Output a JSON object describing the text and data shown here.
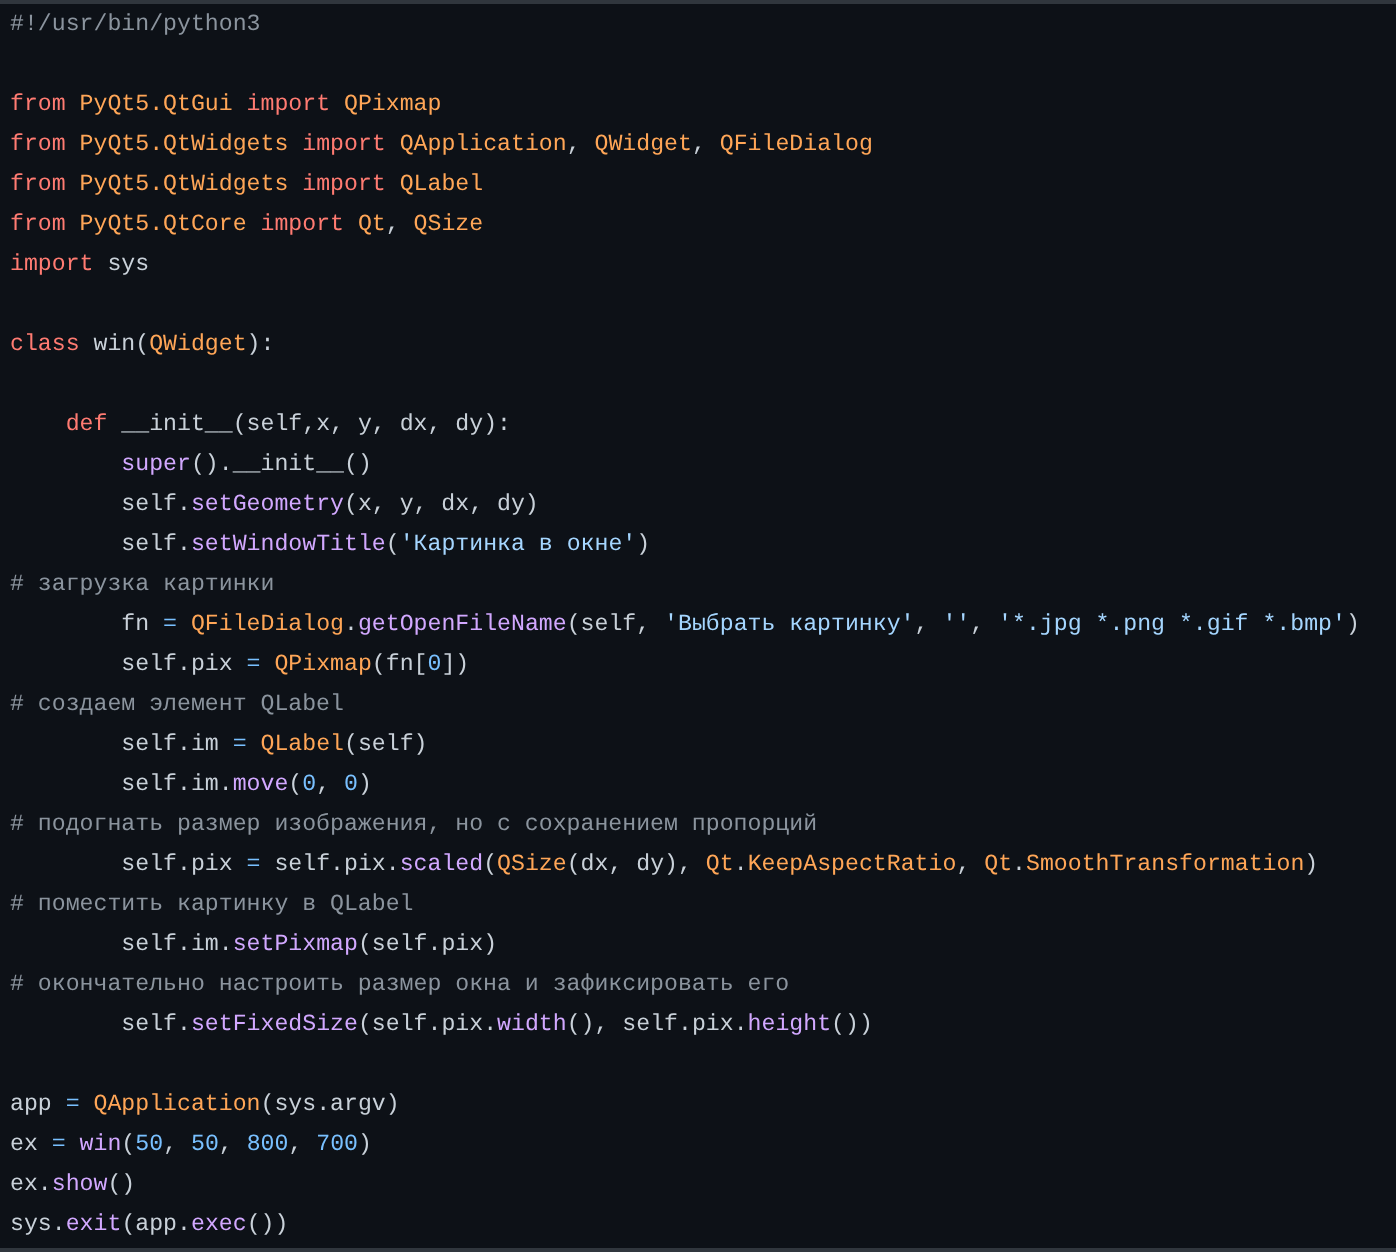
{
  "code_lines": [
    {
      "kind": "code",
      "tokens": [
        {
          "text": "#!/usr/bin/python3",
          "kind": "comment"
        }
      ]
    },
    {
      "kind": "blank"
    },
    {
      "kind": "code",
      "tokens": [
        {
          "text": "from ",
          "kind": "keyword"
        },
        {
          "text": "PyQt5.QtGui ",
          "kind": "class"
        },
        {
          "text": "import ",
          "kind": "keyword"
        },
        {
          "text": "QPixmap",
          "kind": "class"
        }
      ]
    },
    {
      "kind": "code",
      "tokens": [
        {
          "text": "from ",
          "kind": "keyword"
        },
        {
          "text": "PyQt5.QtWidgets ",
          "kind": "class"
        },
        {
          "text": "import ",
          "kind": "keyword"
        },
        {
          "text": "QApplication",
          "kind": "class"
        },
        {
          "text": ", ",
          "kind": "plain"
        },
        {
          "text": "QWidget",
          "kind": "class"
        },
        {
          "text": ", ",
          "kind": "plain"
        },
        {
          "text": "QFileDialog",
          "kind": "class"
        }
      ]
    },
    {
      "kind": "code",
      "tokens": [
        {
          "text": "from ",
          "kind": "keyword"
        },
        {
          "text": "PyQt5.QtWidgets ",
          "kind": "class"
        },
        {
          "text": "import ",
          "kind": "keyword"
        },
        {
          "text": "QLabel",
          "kind": "class"
        }
      ]
    },
    {
      "kind": "code",
      "tokens": [
        {
          "text": "from ",
          "kind": "keyword"
        },
        {
          "text": "PyQt5.QtCore ",
          "kind": "class"
        },
        {
          "text": "import ",
          "kind": "keyword"
        },
        {
          "text": "Qt",
          "kind": "class"
        },
        {
          "text": ", ",
          "kind": "plain"
        },
        {
          "text": "QSize",
          "kind": "class"
        }
      ]
    },
    {
      "kind": "code",
      "tokens": [
        {
          "text": "import ",
          "kind": "keyword"
        },
        {
          "text": "sys",
          "kind": "plain"
        }
      ]
    },
    {
      "kind": "blank"
    },
    {
      "kind": "code",
      "tokens": [
        {
          "text": "class ",
          "kind": "keyword"
        },
        {
          "text": "win(",
          "kind": "plain"
        },
        {
          "text": "QWidget",
          "kind": "class"
        },
        {
          "text": "):",
          "kind": "plain"
        }
      ]
    },
    {
      "kind": "blank"
    },
    {
      "kind": "code",
      "tokens": [
        {
          "text": "    def ",
          "kind": "keyword"
        },
        {
          "text": "__init__(self,x, y, dx, dy):",
          "kind": "plain"
        }
      ]
    },
    {
      "kind": "code",
      "tokens": [
        {
          "text": "        super",
          "kind": "function"
        },
        {
          "text": "().__init__()",
          "kind": "plain"
        }
      ]
    },
    {
      "kind": "code",
      "tokens": [
        {
          "text": "        self.",
          "kind": "plain"
        },
        {
          "text": "setGeometry",
          "kind": "function"
        },
        {
          "text": "(x, y, dx, dy)",
          "kind": "plain"
        }
      ]
    },
    {
      "kind": "code",
      "tokens": [
        {
          "text": "        self.",
          "kind": "plain"
        },
        {
          "text": "setWindowTitle",
          "kind": "function"
        },
        {
          "text": "(",
          "kind": "plain"
        },
        {
          "text": "'Картинка в окне'",
          "kind": "string"
        },
        {
          "text": ")",
          "kind": "plain"
        }
      ]
    },
    {
      "kind": "code",
      "tokens": [
        {
          "text": "# загрузка картинки",
          "kind": "comment"
        }
      ]
    },
    {
      "kind": "code",
      "tokens": [
        {
          "text": "        fn ",
          "kind": "plain"
        },
        {
          "text": "= ",
          "kind": "operator"
        },
        {
          "text": "QFileDialog",
          "kind": "class"
        },
        {
          "text": ".",
          "kind": "plain"
        },
        {
          "text": "getOpenFileName",
          "kind": "function"
        },
        {
          "text": "(self, ",
          "kind": "plain"
        },
        {
          "text": "'Выбрать картинку'",
          "kind": "string"
        },
        {
          "text": ", ",
          "kind": "plain"
        },
        {
          "text": "''",
          "kind": "string"
        },
        {
          "text": ", ",
          "kind": "plain"
        },
        {
          "text": "'*.jpg *.png *.gif *.bmp'",
          "kind": "string"
        },
        {
          "text": ")",
          "kind": "plain"
        }
      ]
    },
    {
      "kind": "code",
      "tokens": [
        {
          "text": "        self.pix ",
          "kind": "plain"
        },
        {
          "text": "= ",
          "kind": "operator"
        },
        {
          "text": "QPixmap",
          "kind": "class"
        },
        {
          "text": "(fn[",
          "kind": "plain"
        },
        {
          "text": "0",
          "kind": "number"
        },
        {
          "text": "])",
          "kind": "plain"
        }
      ]
    },
    {
      "kind": "code",
      "tokens": [
        {
          "text": "# создаем элемент QLabel",
          "kind": "comment"
        }
      ]
    },
    {
      "kind": "code",
      "tokens": [
        {
          "text": "        self.im ",
          "kind": "plain"
        },
        {
          "text": "= ",
          "kind": "operator"
        },
        {
          "text": "QLabel",
          "kind": "class"
        },
        {
          "text": "(self)",
          "kind": "plain"
        }
      ]
    },
    {
      "kind": "code",
      "tokens": [
        {
          "text": "        self.im.",
          "kind": "plain"
        },
        {
          "text": "move",
          "kind": "function"
        },
        {
          "text": "(",
          "kind": "plain"
        },
        {
          "text": "0",
          "kind": "number"
        },
        {
          "text": ", ",
          "kind": "plain"
        },
        {
          "text": "0",
          "kind": "number"
        },
        {
          "text": ")",
          "kind": "plain"
        }
      ]
    },
    {
      "kind": "code",
      "tokens": [
        {
          "text": "# подогнать размер изображения, но с сохранением пропорций",
          "kind": "comment"
        }
      ]
    },
    {
      "kind": "code",
      "tokens": [
        {
          "text": "        self.pix ",
          "kind": "plain"
        },
        {
          "text": "= ",
          "kind": "operator"
        },
        {
          "text": "self.pix.",
          "kind": "plain"
        },
        {
          "text": "scaled",
          "kind": "function"
        },
        {
          "text": "(",
          "kind": "plain"
        },
        {
          "text": "QSize",
          "kind": "class"
        },
        {
          "text": "(dx, dy), ",
          "kind": "plain"
        },
        {
          "text": "Qt",
          "kind": "class"
        },
        {
          "text": ".",
          "kind": "plain"
        },
        {
          "text": "KeepAspectRatio",
          "kind": "class"
        },
        {
          "text": ", ",
          "kind": "plain"
        },
        {
          "text": "Qt",
          "kind": "class"
        },
        {
          "text": ".",
          "kind": "plain"
        },
        {
          "text": "SmoothTransformation",
          "kind": "class"
        },
        {
          "text": ")",
          "kind": "plain"
        }
      ]
    },
    {
      "kind": "code",
      "tokens": [
        {
          "text": "# поместить картинку в QLabel",
          "kind": "comment"
        }
      ]
    },
    {
      "kind": "code",
      "tokens": [
        {
          "text": "        self.im.",
          "kind": "plain"
        },
        {
          "text": "setPixmap",
          "kind": "function"
        },
        {
          "text": "(self.pix)",
          "kind": "plain"
        }
      ]
    },
    {
      "kind": "code",
      "tokens": [
        {
          "text": "# окончательно настроить размер окна и зафиксировать его",
          "kind": "comment"
        }
      ]
    },
    {
      "kind": "code",
      "tokens": [
        {
          "text": "        self.",
          "kind": "plain"
        },
        {
          "text": "setFixedSize",
          "kind": "function"
        },
        {
          "text": "(self.pix.",
          "kind": "plain"
        },
        {
          "text": "width",
          "kind": "function"
        },
        {
          "text": "(), self.pix.",
          "kind": "plain"
        },
        {
          "text": "height",
          "kind": "function"
        },
        {
          "text": "())",
          "kind": "plain"
        }
      ]
    },
    {
      "kind": "blank"
    },
    {
      "kind": "code",
      "tokens": [
        {
          "text": "app ",
          "kind": "plain"
        },
        {
          "text": "= ",
          "kind": "operator"
        },
        {
          "text": "QApplication",
          "kind": "class"
        },
        {
          "text": "(sys.argv)",
          "kind": "plain"
        }
      ]
    },
    {
      "kind": "code",
      "tokens": [
        {
          "text": "ex ",
          "kind": "plain"
        },
        {
          "text": "= ",
          "kind": "operator"
        },
        {
          "text": "win",
          "kind": "function"
        },
        {
          "text": "(",
          "kind": "plain"
        },
        {
          "text": "50",
          "kind": "number"
        },
        {
          "text": ", ",
          "kind": "plain"
        },
        {
          "text": "50",
          "kind": "number"
        },
        {
          "text": ", ",
          "kind": "plain"
        },
        {
          "text": "800",
          "kind": "number"
        },
        {
          "text": ", ",
          "kind": "plain"
        },
        {
          "text": "700",
          "kind": "number"
        },
        {
          "text": ")",
          "kind": "plain"
        }
      ]
    },
    {
      "kind": "code",
      "tokens": [
        {
          "text": "ex.",
          "kind": "plain"
        },
        {
          "text": "show",
          "kind": "function"
        },
        {
          "text": "()",
          "kind": "plain"
        }
      ]
    },
    {
      "kind": "code",
      "tokens": [
        {
          "text": "sys.",
          "kind": "plain"
        },
        {
          "text": "exit",
          "kind": "function"
        },
        {
          "text": "(app.",
          "kind": "plain"
        },
        {
          "text": "exec",
          "kind": "function"
        },
        {
          "text": "())",
          "kind": "plain"
        }
      ]
    }
  ]
}
